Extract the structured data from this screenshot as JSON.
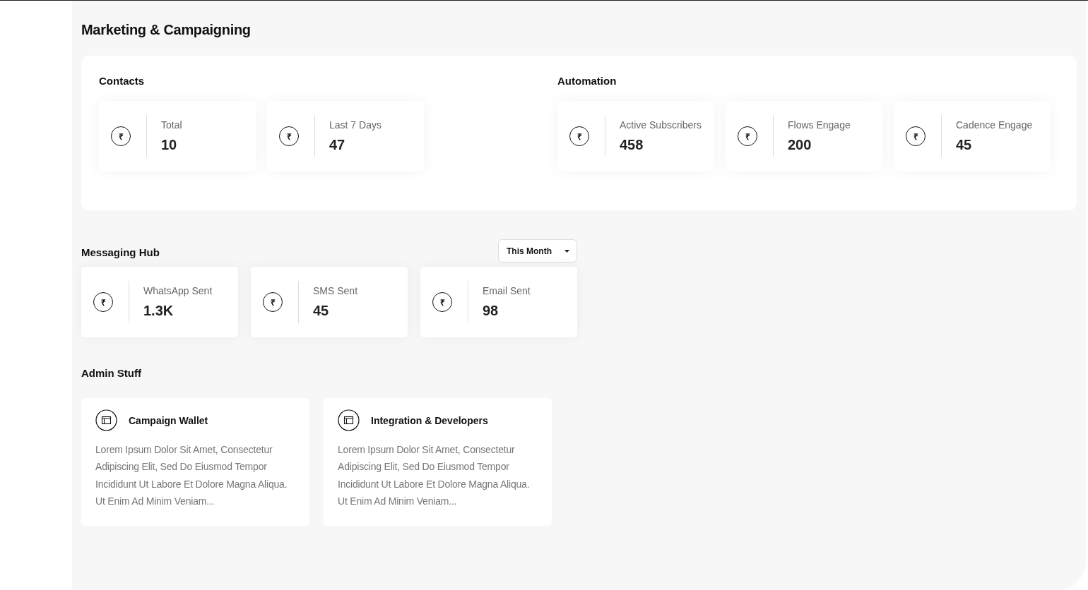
{
  "page_title": "Marketing & Campaigning",
  "overview": {
    "groups": [
      {
        "title": "Contacts",
        "stats": [
          {
            "symbol": "₹",
            "label": "Total",
            "value": "10"
          },
          {
            "symbol": "₹",
            "label": "Last 7 Days",
            "value": "47"
          }
        ]
      },
      {
        "title": "Automation",
        "stats": [
          {
            "symbol": "₹",
            "label": "Active Subscribers",
            "value": "458"
          },
          {
            "symbol": "₹",
            "label": "Flows Engage",
            "value": "200"
          },
          {
            "symbol": "₹",
            "label": "Cadence Engage",
            "value": "45"
          }
        ]
      }
    ]
  },
  "messaging_hub": {
    "title": "Messaging Hub",
    "period_dropdown": {
      "value": "This Month"
    },
    "stats": [
      {
        "symbol": "₹",
        "label": "WhatsApp Sent",
        "value": "1.3K"
      },
      {
        "symbol": "₹",
        "label": "SMS Sent",
        "value": "45"
      },
      {
        "symbol": "₹",
        "label": "Email Sent",
        "value": "98"
      }
    ]
  },
  "admin": {
    "title": "Admin Stuff",
    "cards": [
      {
        "title": "Campaign Wallet",
        "description": "Lorem Ipsum Dolor Sit Amet, Consectetur Adipiscing Elit, Sed Do Eiusmod Tempor Incididunt Ut Labore Et Dolore Magna Aliqua. Ut Enim Ad Minim Veniam..."
      },
      {
        "title": "Integration & Developers",
        "description": "Lorem Ipsum Dolor Sit Amet, Consectetur Adipiscing Elit, Sed Do Eiusmod Tempor Incididunt Ut Labore Et Dolore Magna Aliqua. Ut Enim Ad Minim Veniam..."
      }
    ]
  }
}
